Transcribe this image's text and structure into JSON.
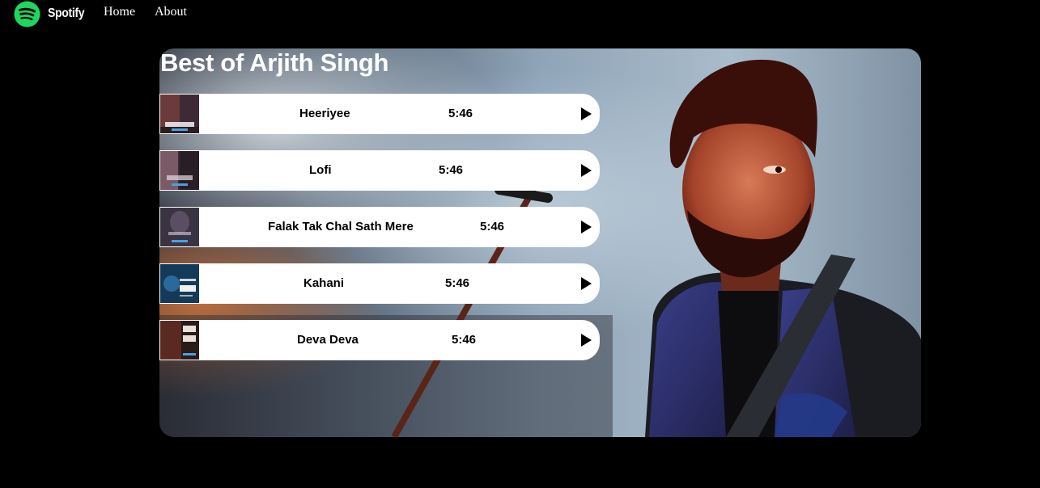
{
  "nav": {
    "brand": "Spotify",
    "links": [
      {
        "label": "Home"
      },
      {
        "label": "About"
      }
    ]
  },
  "playlist": {
    "title": "Best of Arjith Singh",
    "songs": [
      {
        "name": "Heeriyee",
        "duration": "5:46"
      },
      {
        "name": "Lofi",
        "duration": "5:46"
      },
      {
        "name": "Falak Tak Chal Sath Mere",
        "duration": "5:46"
      },
      {
        "name": "Kahani",
        "duration": "5:46"
      },
      {
        "name": "Deva Deva",
        "duration": "5:46"
      }
    ]
  },
  "colors": {
    "background": "#000000",
    "brand_green": "#1ED760",
    "song_row": "#FFFFFF"
  },
  "icons": {
    "logo": "spotify-logo-icon",
    "play": "play-icon"
  }
}
